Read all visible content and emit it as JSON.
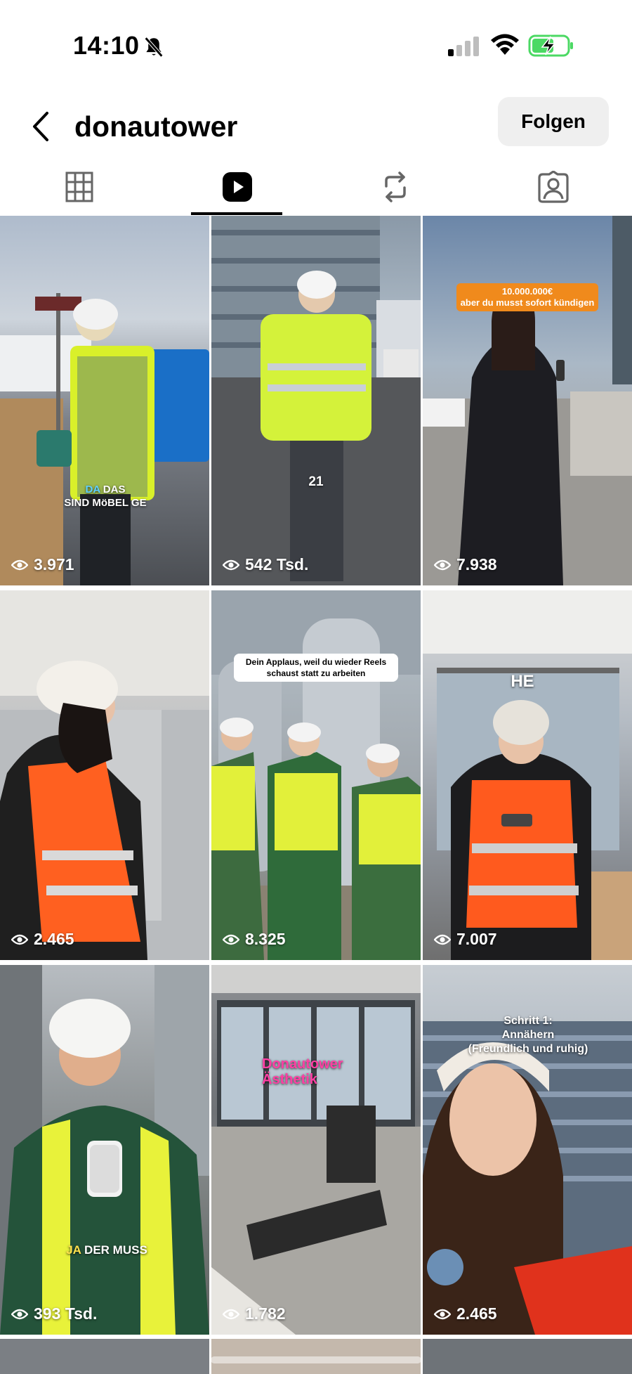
{
  "status_bar": {
    "time": "14:10",
    "icons": [
      "bell-slash-icon",
      "signal-icon",
      "wifi-icon",
      "battery-charging-icon"
    ],
    "battery_color": "#4cd964"
  },
  "header": {
    "back_icon": "chevron-left-icon",
    "profile_name": "donautower",
    "follow_label": "Folgen"
  },
  "tabs": [
    {
      "name": "grid",
      "icon": "grid-icon",
      "active": false
    },
    {
      "name": "reels",
      "icon": "reels-icon",
      "active": true
    },
    {
      "name": "reposts",
      "icon": "repost-icon",
      "active": false
    },
    {
      "name": "tagged",
      "icon": "tagged-person-icon",
      "active": false
    }
  ],
  "reels": [
    {
      "views": "3.971",
      "caption": "DA DAS SIND MöBEL GE",
      "caption_highlight": "DA"
    },
    {
      "views": "542 Tsd.",
      "caption": "21"
    },
    {
      "views": "7.938",
      "caption": "10.000.000€\naber du musst sofort kündigen"
    },
    {
      "views": "2.465",
      "caption": ""
    },
    {
      "views": "8.325",
      "caption": "Dein Applaus, weil du wieder Reels schaust statt zu arbeiten"
    },
    {
      "views": "7.007",
      "caption": "HE"
    },
    {
      "views": "393 Tsd.",
      "caption": "DER MUSS",
      "caption_highlight": "JA"
    },
    {
      "views": "1.782",
      "caption": "Donautower Ästhetik"
    },
    {
      "views": "2.465",
      "caption": "Schritt 1:\nAnnähern\n(Freundlich und ruhig)"
    }
  ],
  "colors": {
    "accent": "#000000",
    "follow_bg": "#efefef",
    "orange_label": "#f08a1c",
    "yellow_highlight": "#ffe14d",
    "pink_caption": "#ff3fa4"
  }
}
